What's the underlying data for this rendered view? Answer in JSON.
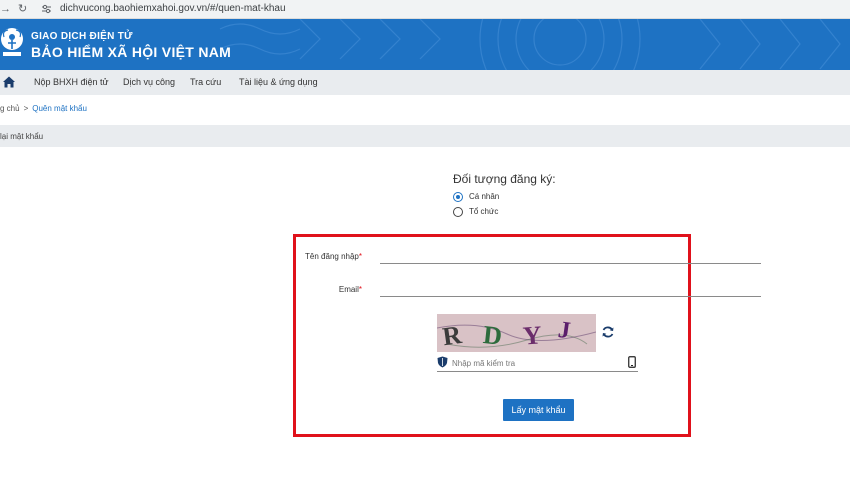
{
  "browser": {
    "back_icon": "arrow-right-icon",
    "reload_icon": "reload-icon",
    "site_settings_icon": "tune-icon",
    "url": "dichvucong.baohiemxahoi.gov.vn/#/quen-mat-khau"
  },
  "banner": {
    "logo_icon": "bhxh-logo",
    "line1": "GIAO DỊCH ĐIỆN TỬ",
    "line2": "BẢO HIỂM XÃ HỘI VIỆT NAM",
    "background_color": "#1e72c3"
  },
  "nav": {
    "home_icon": "home-icon",
    "items": [
      {
        "label": "Nộp BHXH điện tử"
      },
      {
        "label": "Dịch vụ công"
      },
      {
        "label": "Tra cứu"
      },
      {
        "label": "Tài liệu & ứng dụng"
      }
    ]
  },
  "breadcrumb": {
    "home": "g chủ",
    "separator": ">",
    "current": "Quên mật khẩu"
  },
  "section": {
    "title": "lại mật khẩu"
  },
  "form": {
    "subject_label": "Đối tượng đăng ký:",
    "subject_options": [
      {
        "label": "Cá nhân",
        "selected": true
      },
      {
        "label": "Tổ chức",
        "selected": false
      }
    ],
    "username_label": "Tên đăng nhập",
    "username_value": "",
    "email_label": "Email",
    "email_value": "",
    "required_mark": "*",
    "captcha_text": "RDYJ",
    "refresh_icon": "refresh-icon",
    "captcha_shield_icon": "shield-icon",
    "captcha_placeholder": "Nhập mã kiểm tra",
    "captcha_value": "",
    "phone_icon": "phone-icon",
    "submit_label": "Lấy mật khẩu",
    "accent_color": "#1e72c3",
    "highlight_color": "#e0111b"
  }
}
